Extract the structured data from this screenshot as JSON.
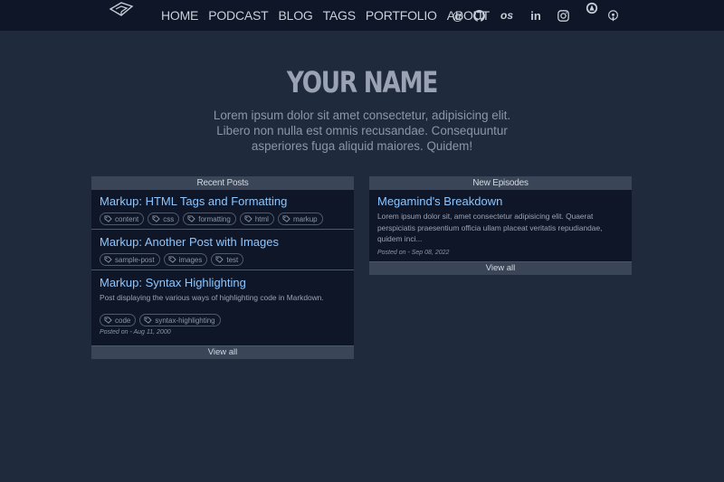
{
  "nav": {
    "links": [
      "HOME",
      "PODCAST",
      "BLOG",
      "TAGS",
      "PORTFOLIO",
      "ABOUT"
    ],
    "social_icons": [
      "at-icon",
      "github-icon",
      "lastfm-icon",
      "linkedin-icon",
      "instagram-icon",
      "podcast-app-icon",
      "podcast-icon"
    ]
  },
  "hero": {
    "title": "YOUR NAME",
    "text": "Lorem ipsum dolor sit amet consectetur, adipisicing elit. Libero non nulla est omnis recusandae. Consequuntur asperiores fuga aliquid maiores. Quidem!"
  },
  "recent_posts": {
    "header": "Recent Posts",
    "posts": [
      {
        "title": "Markup: HTML Tags and Formatting",
        "tags": [
          "content",
          "css",
          "formatting",
          "html",
          "markup"
        ]
      },
      {
        "title": "Markup: Another Post with Images",
        "tags": [
          "sample-post",
          "images",
          "test"
        ]
      },
      {
        "title": "Markup: Syntax Highlighting",
        "description": "Post displaying the various ways of highlighting code in Markdown.",
        "tags": [
          "code",
          "syntax-highlighting"
        ],
        "date": "Posted on - Aug 11, 2000"
      }
    ],
    "view_all": "View all"
  },
  "new_episodes": {
    "header": "New Episodes",
    "episodes": [
      {
        "title": "Megamind's Breakdown",
        "description": "Lorem ipsum dolor sit, amet consectetur adipisicing elit. Quaerat perspiciatis praesentium officia ullam placeat veritatis repudiandae, quidem inci...",
        "date": "Posted on - Sep 08, 2022"
      }
    ],
    "view_all": "View all"
  },
  "colors": {
    "background": "#1f2a3c",
    "navbar": "#0e1627",
    "link": "#8dc6ff",
    "panel_header": "#3a4657"
  }
}
